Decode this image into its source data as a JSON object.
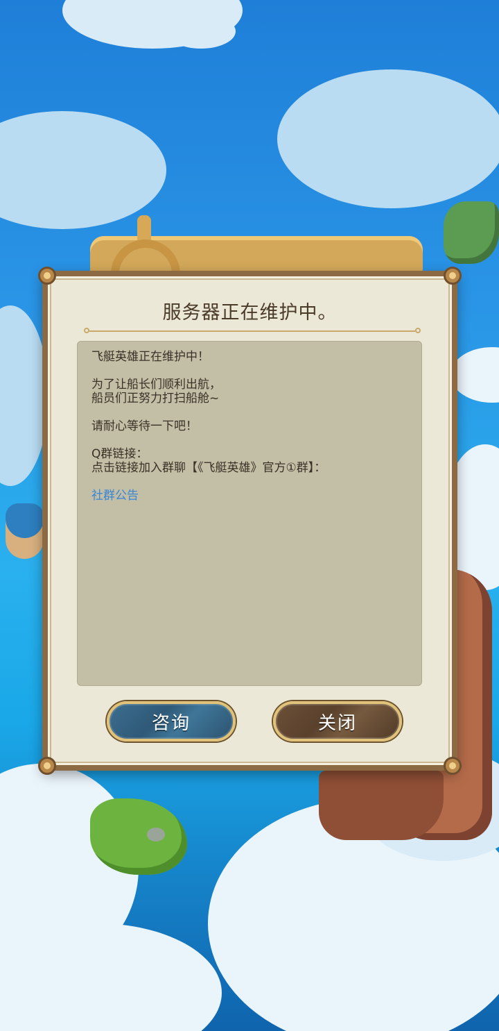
{
  "dialog": {
    "title": "服务器正在维护中。",
    "message": {
      "line1": "飞艇英雄正在维护中！",
      "line2": "为了让船长们顺利出航，",
      "line3": "船员们正努力打扫船舱~",
      "line4": "请耐心等待一下吧！",
      "line5": "Q群链接：",
      "line6": "点击链接加入群聊【《飞艇英雄》官方①群】："
    },
    "link_label": "社群公告",
    "buttons": {
      "consult_label": "咨询",
      "close_label": "关闭"
    }
  },
  "colors": {
    "link": "#3a86d4",
    "consult_button": "#2f5977",
    "close_button": "#5a412c",
    "dialog_frame": "#8c6a44",
    "dialog_bg": "#ece8d7"
  },
  "icons": [
    "ship-wheel-icon",
    "corner-rivet-icon"
  ]
}
